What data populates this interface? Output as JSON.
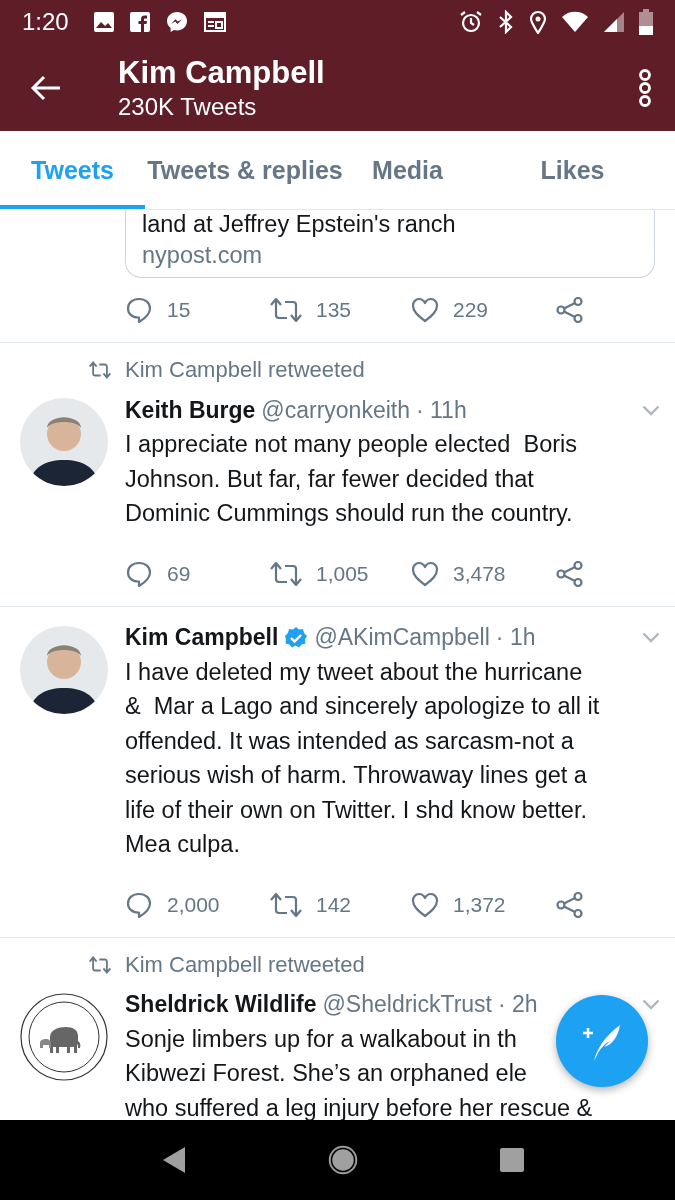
{
  "status_bar": {
    "time": "1:20"
  },
  "header": {
    "title": "Kim Campbell",
    "subtitle": "230K Tweets"
  },
  "tabs": [
    {
      "label": "Tweets",
      "selected": true
    },
    {
      "label": "Tweets & replies",
      "selected": false
    },
    {
      "label": "Media",
      "selected": false
    },
    {
      "label": "Likes",
      "selected": false
    }
  ],
  "tweets": [
    {
      "kind": "partial",
      "card": {
        "title": "land at Jeffrey Epstein's ranch",
        "domain": "nypost.com"
      },
      "actions": {
        "replies": "15",
        "retweets": "135",
        "likes": "229"
      }
    },
    {
      "kind": "tweet",
      "retweeted_by": "Kim Campbell retweeted",
      "avatar": {
        "kind": "person"
      },
      "name": "Keith Burge",
      "verified": false,
      "handle": "@carryonkeith",
      "time": "· 11h",
      "lines": [
        "I appreciate not many people elected  Boris",
        "Johnson. But far, far fewer decided that",
        "Dominic Cummings should run the country."
      ],
      "actions": {
        "replies": "69",
        "retweets": "1,005",
        "likes": "3,478"
      }
    },
    {
      "kind": "tweet",
      "avatar": {
        "kind": "person"
      },
      "name": "Kim Campbell",
      "verified": true,
      "handle": "@AKimCampbell",
      "time": "· 1h",
      "lines": [
        "I have deleted my tweet about the hurricane",
        "&  Mar a Lago and sincerely apologize to all it",
        "offended. It was intended as sarcasm-not a",
        "serious wish of harm. Throwaway lines get a",
        "life of their own on Twitter. I shd know better.",
        "Mea culpa."
      ],
      "actions": {
        "replies": "2,000",
        "retweets": "142",
        "likes": "1,372"
      }
    },
    {
      "kind": "tweet",
      "retweeted_by": "Kim Campbell retweeted",
      "avatar": {
        "kind": "logo"
      },
      "name": "Sheldrick Wildlife",
      "verified": false,
      "handle": "@SheldrickTrust",
      "time": "· 2h",
      "lines": [
        "Sonje limbers up for a walkabout in th",
        "Kibwezi Forest. She’s an orphaned ele",
        "who suffered a leg injury before her rescue &"
      ]
    }
  ]
}
